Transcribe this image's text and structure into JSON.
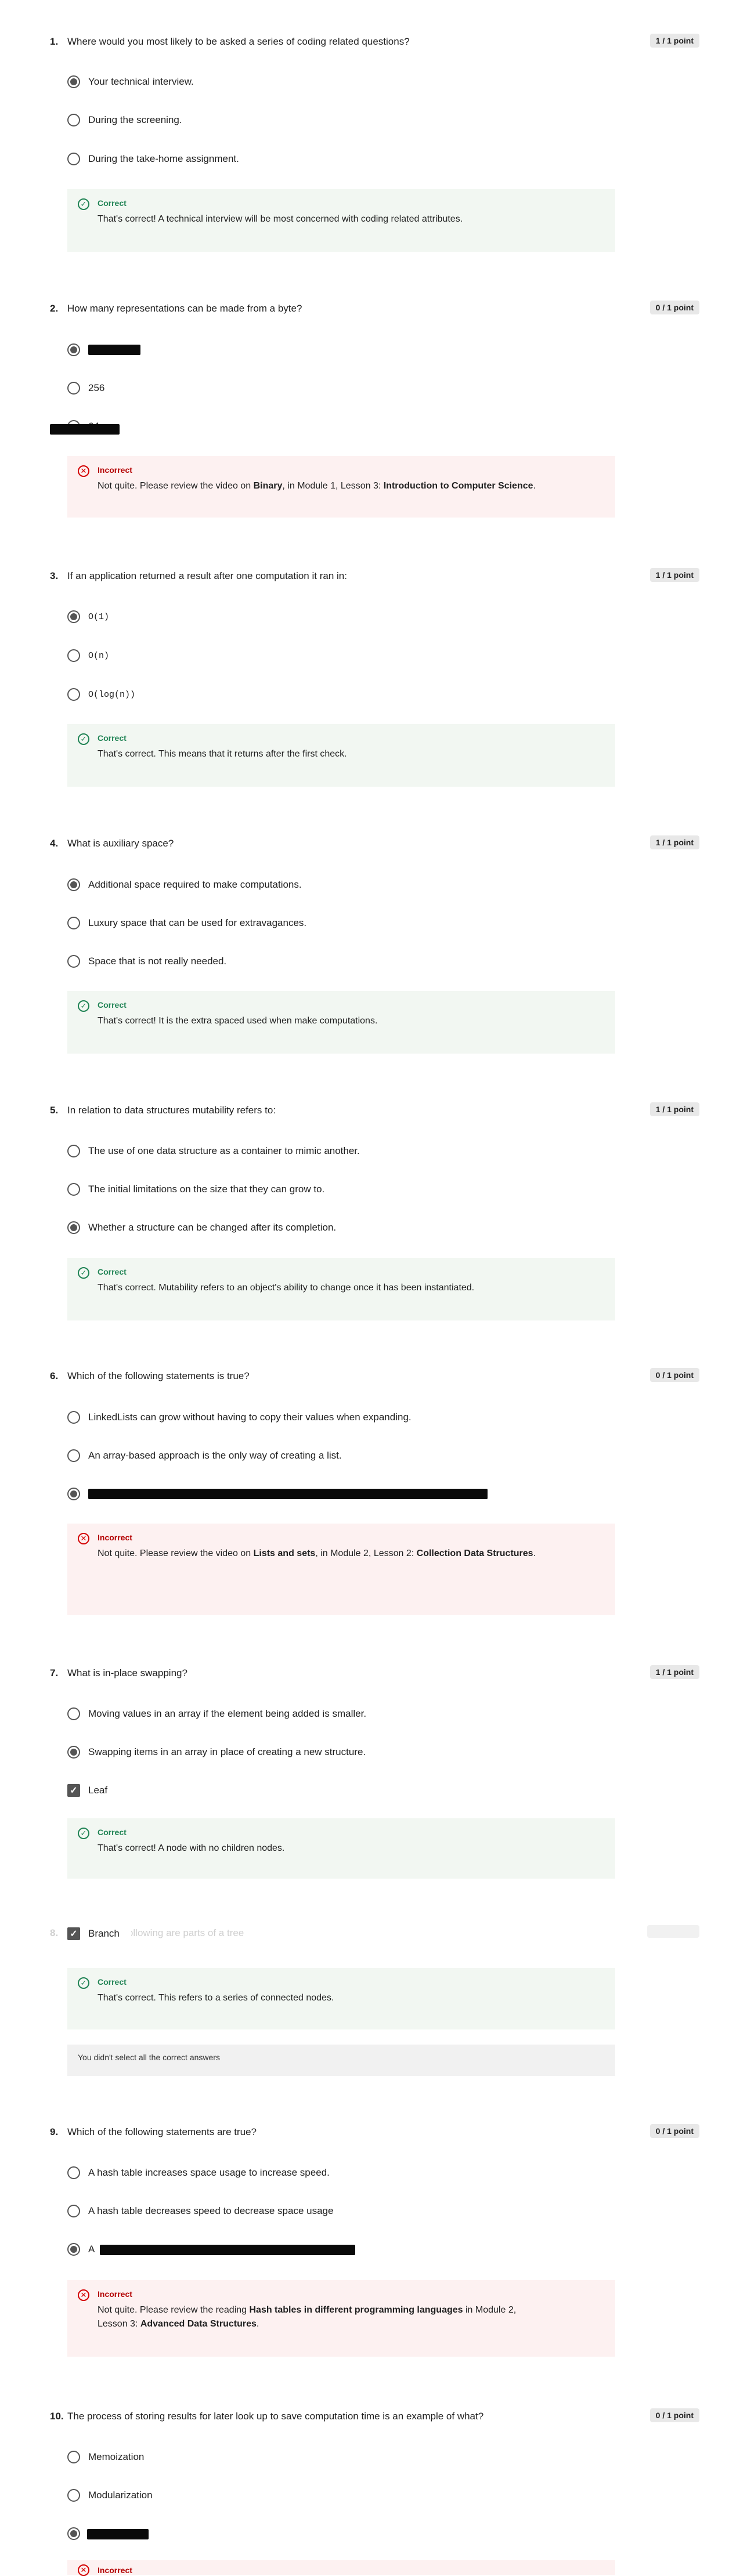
{
  "questions": [
    {
      "number": "1.",
      "text": "Where would you most likely to be asked a series of coding related questions?",
      "points": "1 / 1 point",
      "options": [
        "Your technical interview.",
        "During the screening.",
        "During the take-home assignment."
      ],
      "feedback": {
        "status": "Correct",
        "message": "That's correct! A technical interview will be most concerned with coding related attributes."
      }
    },
    {
      "number": "2.",
      "text": "How many representations can be made from a byte?",
      "points": "0 / 1 point",
      "options": [
        "",
        "256",
        "64"
      ],
      "feedback": {
        "status": "Incorrect",
        "pre": "Not quite. Please review the video on ",
        "b1": "Binary",
        "mid": ", in Module 1, Lesson 3: ",
        "b2": "Introduction to Computer Science",
        "post": "."
      }
    },
    {
      "number": "3.",
      "text": "If an application returned a result after one computation it ran in:",
      "points": "1 / 1 point",
      "options": [
        "O(1)",
        "O(n)",
        "O(log(n))"
      ],
      "feedback": {
        "status": "Correct",
        "message": "That's correct. This means that it returns after the first check."
      }
    },
    {
      "number": "4.",
      "text": "What is auxiliary space?",
      "points": "1 / 1 point",
      "options": [
        "Additional space required to make computations.",
        "Luxury space that can be used for extravagances.",
        "Space that is not really needed."
      ],
      "feedback": {
        "status": "Correct",
        "message": "That's correct! It is the extra spaced used when make computations."
      }
    },
    {
      "number": "5.",
      "text": "In relation to data structures mutability refers to:",
      "points": "1 / 1 point",
      "options": [
        "The use of one data structure as a container to mimic another.",
        "The initial limitations on the size that they can grow to.",
        "Whether a structure can be changed after its completion."
      ],
      "feedback": {
        "status": "Correct",
        "message": "That's correct. Mutability refers to an object's ability to change once it has been instantiated."
      }
    },
    {
      "number": "6.",
      "text": "Which of the following statements is true?",
      "points": "0 / 1 point",
      "options": [
        "LinkedLists can grow without having to copy their values when expanding.",
        "An array-based approach is the only way of creating a list.",
        ""
      ],
      "feedback": {
        "status": "Incorrect",
        "pre": "Not quite. Please review the video on ",
        "b1": "Lists and sets",
        "mid": ", in Module 2, Lesson 2: ",
        "b2": "Collection Data Structures",
        "post": "."
      }
    },
    {
      "number": "7.",
      "text": "What is in-place swapping?",
      "points": "1 / 1 point",
      "options": [
        "Moving values in an array if the element being added is smaller.",
        "Swapping items in an array in place of creating a new structure.",
        "Leaf"
      ],
      "feedback": {
        "status": "Correct",
        "message": "That's correct! A node with no children nodes."
      }
    },
    {
      "number": "8.",
      "text": "Which of the following are parts of a tree",
      "points": "",
      "options": [
        "Branch"
      ],
      "feedback": {
        "status": "Correct",
        "message": "That's correct. This refers to a series of connected nodes."
      },
      "note": "You didn't select all the correct answers"
    },
    {
      "number": "9.",
      "text": "Which of the following statements are true?",
      "points": "0 / 1 point",
      "options": [
        "A hash table increases space usage to increase speed.",
        "A hash table decreases speed to decrease space usage",
        "A"
      ],
      "feedback": {
        "status": "Incorrect",
        "pre": "Not quite. Please review the reading ",
        "b1": "Hash tables in different programming languages",
        "mid": " in Module 2,",
        "line2pre": "Lesson 3: ",
        "b2": "Advanced Data Structures",
        "post": "."
      }
    },
    {
      "number": "10.",
      "text": "The process of storing results for later look up to save computation time is an example of what?",
      "points": "0 / 1 point",
      "options": [
        "Memoization",
        "Modularization",
        ""
      ],
      "feedback": {
        "status": "Incorrect"
      }
    }
  ],
  "icons": {
    "correct": "check-circle-icon",
    "incorrect": "x-circle-icon",
    "checkbox": "checkmark-icon"
  },
  "colors": {
    "correct_bg": "#f2f7f2",
    "incorrect_bg": "#fdf1f1",
    "correct_text": "#1f8354",
    "incorrect_text": "#b30000",
    "points_badge": "#e8e8e8"
  }
}
